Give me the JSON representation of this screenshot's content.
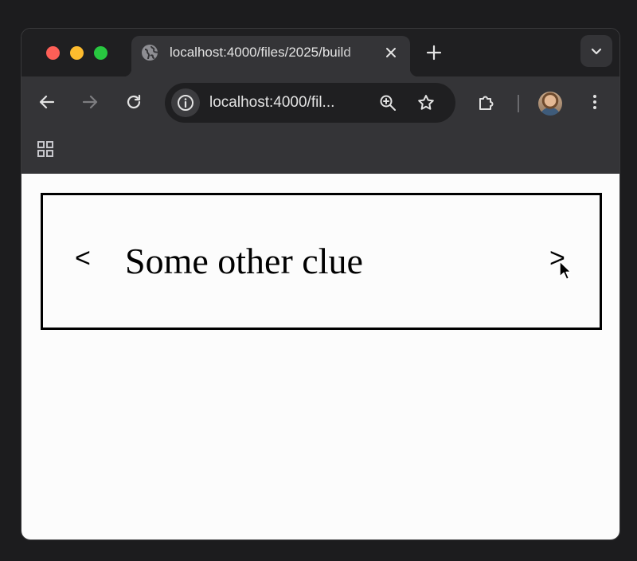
{
  "browser": {
    "tab": {
      "title": "localhost:4000/files/2025/build",
      "favicon": "globe-icon",
      "close_icon": "close-icon"
    },
    "new_tab_icon": "plus-icon",
    "tab_search_icon": "chevron-down-icon",
    "toolbar": {
      "back_icon": "arrow-left-icon",
      "forward_icon": "arrow-right-icon",
      "reload_icon": "reload-icon",
      "site_info_icon": "info-icon",
      "url": "localhost:4000/fil...",
      "zoom_icon": "zoom-in-icon",
      "bookmark_icon": "star-icon",
      "extensions_icon": "puzzle-icon",
      "profile_icon": "avatar",
      "menu_icon": "kebab-menu-icon"
    },
    "bookmarks_bar": {
      "apps_icon": "apps-grid-icon"
    }
  },
  "page": {
    "prev_label": "<",
    "clue": "Some other clue",
    "next_label": ">"
  },
  "colors": {
    "chrome_dark": "#1f1f21",
    "toolbar": "#343437",
    "page_bg": "#fcfcfc",
    "text": "#e3e3e3"
  }
}
